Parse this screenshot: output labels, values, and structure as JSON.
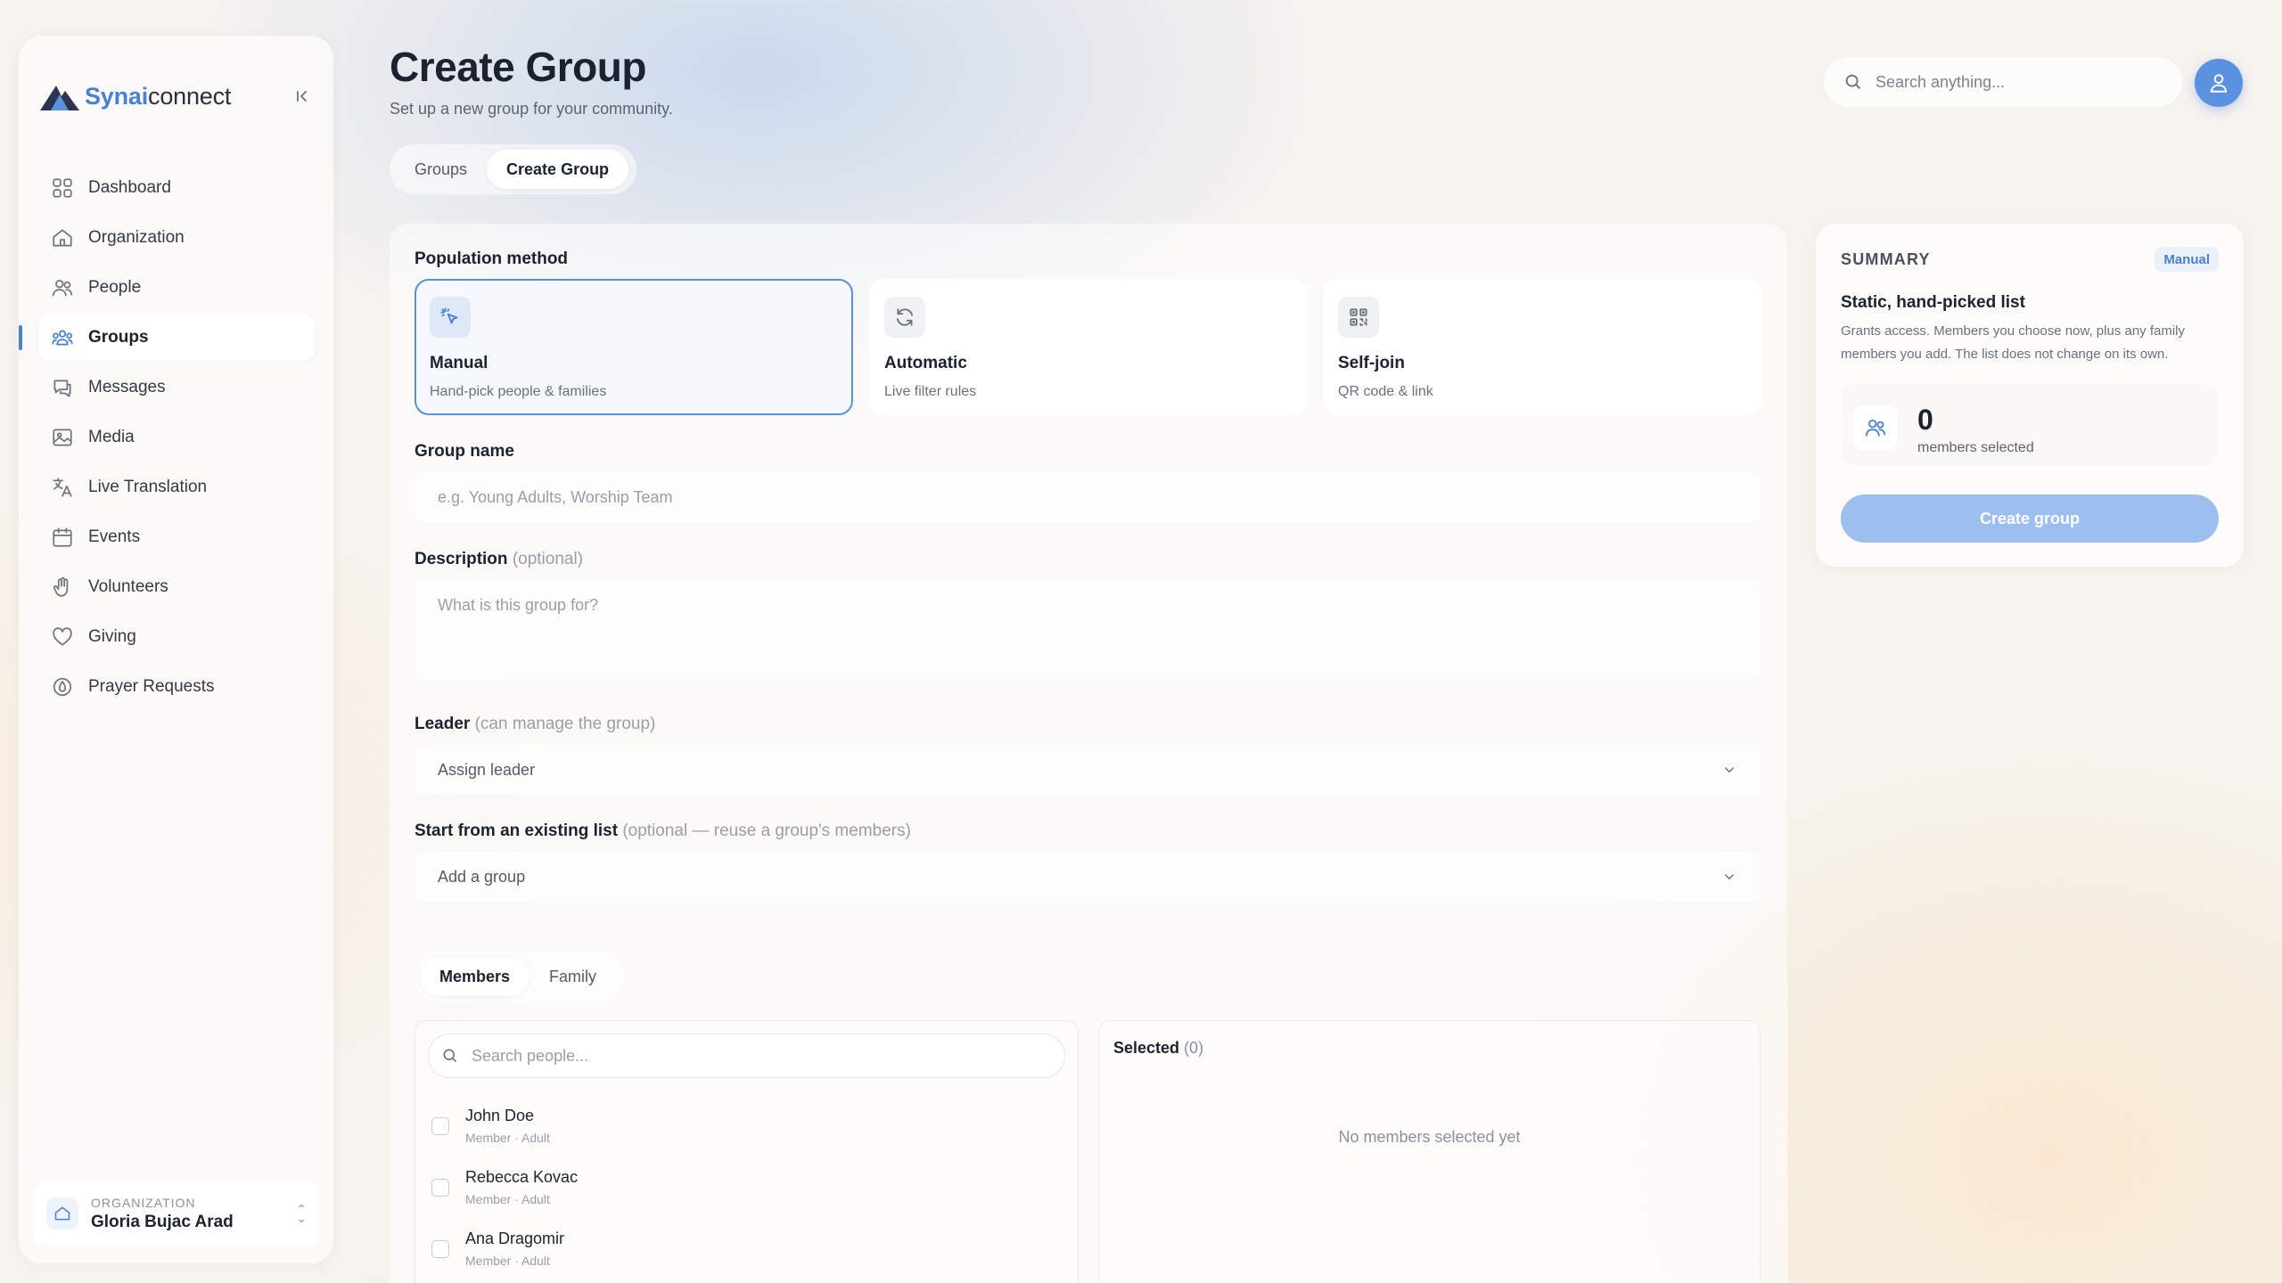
{
  "brand": {
    "name_part1": "Synai",
    "name_part2": "connect"
  },
  "sidebar": {
    "items": [
      {
        "label": "Dashboard",
        "icon": "dashboard-icon"
      },
      {
        "label": "Organization",
        "icon": "home-icon"
      },
      {
        "label": "People",
        "icon": "people-icon"
      },
      {
        "label": "Groups",
        "icon": "groups-icon",
        "active": true
      },
      {
        "label": "Messages",
        "icon": "messages-icon"
      },
      {
        "label": "Media",
        "icon": "image-icon"
      },
      {
        "label": "Live Translation",
        "icon": "translate-icon"
      },
      {
        "label": "Events",
        "icon": "calendar-icon"
      },
      {
        "label": "Volunteers",
        "icon": "hand-icon"
      },
      {
        "label": "Giving",
        "icon": "heart-icon"
      },
      {
        "label": "Prayer Requests",
        "icon": "prayer-icon"
      }
    ],
    "org": {
      "caption": "ORGANIZATION",
      "name": "Gloria Bujac Arad"
    }
  },
  "header": {
    "title": "Create Group",
    "subtitle": "Set up a new group for your community.",
    "tabs": [
      {
        "label": "Groups"
      },
      {
        "label": "Create Group",
        "active": true
      }
    ],
    "search_placeholder": "Search anything..."
  },
  "form": {
    "population_label": "Population method",
    "methods": [
      {
        "title": "Manual",
        "desc": "Hand-pick people & families",
        "icon": "cursor-click-icon",
        "selected": true
      },
      {
        "title": "Automatic",
        "desc": "Live filter rules",
        "icon": "refresh-icon"
      },
      {
        "title": "Self-join",
        "desc": "QR code & link",
        "icon": "qr-code-icon"
      }
    ],
    "group_name_label": "Group name",
    "group_name_placeholder": "e.g. Young Adults, Worship Team",
    "description_label": "Description",
    "description_hint": "(optional)",
    "description_placeholder": "What is this group for?",
    "leader_label": "Leader",
    "leader_hint": "(can manage the group)",
    "leader_value": "Assign leader",
    "existing_label": "Start from an existing list",
    "existing_hint": "(optional — reuse a group's members)",
    "existing_value": "Add a group",
    "member_tabs": [
      {
        "label": "Members",
        "active": true
      },
      {
        "label": "Family"
      }
    ],
    "people_search_placeholder": "Search people...",
    "people": [
      {
        "name": "John Doe",
        "meta": "Member · Adult"
      },
      {
        "name": "Rebecca Kovac",
        "meta": "Member · Adult"
      },
      {
        "name": "Ana Dragomir",
        "meta": "Member · Adult"
      }
    ],
    "selected_label": "Selected",
    "selected_count": "(0)",
    "selected_empty": "No members selected yet"
  },
  "summary": {
    "caption": "SUMMARY",
    "badge": "Manual",
    "title": "Static, hand-picked list",
    "desc": "Grants access. Members you choose now, plus any family members you add. The list does not change on its own.",
    "count": "0",
    "count_label": "members selected",
    "button": "Create group"
  },
  "colors": {
    "accent": "#4a7fd1",
    "button_disabled": "#9cbff0"
  }
}
